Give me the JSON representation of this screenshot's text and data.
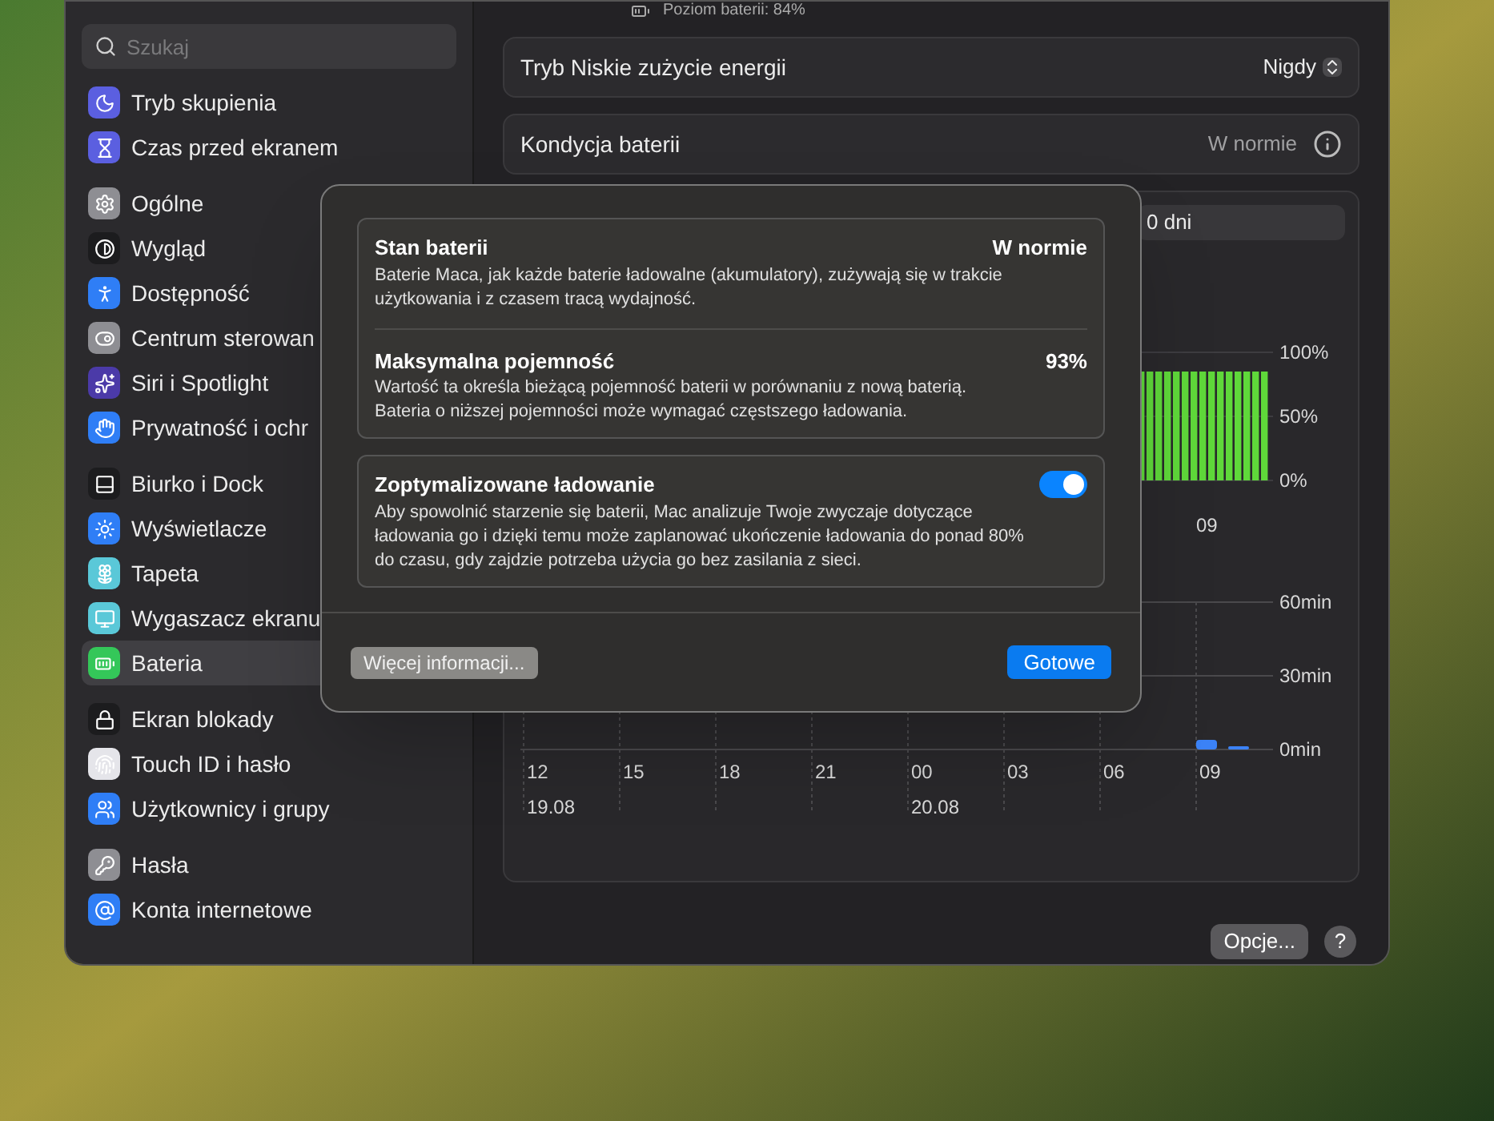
{
  "sidebar": {
    "search": {
      "placeholder": "Szukaj"
    },
    "groups": [
      [
        {
          "label": "Tryb skupienia",
          "selected": false
        },
        {
          "label": "Czas przed ekranem",
          "selected": false
        }
      ],
      [
        {
          "label": "Ogólne",
          "selected": false
        },
        {
          "label": "Wygląd",
          "selected": false
        },
        {
          "label": "Dostępność",
          "selected": false
        },
        {
          "label": "Centrum sterowan",
          "selected": false
        },
        {
          "label": "Siri i Spotlight",
          "selected": false
        },
        {
          "label": "Prywatność i ochr",
          "selected": false
        }
      ],
      [
        {
          "label": "Biurko i Dock",
          "selected": false
        },
        {
          "label": "Wyświetlacze",
          "selected": false
        },
        {
          "label": "Tapeta",
          "selected": false
        },
        {
          "label": "Wygaszacz ekranu",
          "selected": false
        },
        {
          "label": "Bateria",
          "selected": true
        }
      ],
      [
        {
          "label": "Ekran blokady",
          "selected": false
        },
        {
          "label": "Touch ID i hasło",
          "selected": false
        },
        {
          "label": "Użytkownicy i grupy",
          "selected": false
        }
      ],
      [
        {
          "label": "Hasła",
          "selected": false
        },
        {
          "label": "Konta internetowe",
          "selected": false
        }
      ]
    ]
  },
  "main": {
    "battery_level": "Poziom baterii: 84%",
    "rows": [
      {
        "kind": "popup",
        "label": "Tryb Niskie zużycie energii",
        "value": "Nigdy"
      },
      {
        "kind": "info",
        "label": "Kondycja baterii",
        "value": "W normie"
      }
    ],
    "range_segment": "0 dni",
    "battery_chart": {
      "y_labels": [
        "100%",
        "50%",
        "0%"
      ],
      "x_labels": [
        "09"
      ]
    },
    "usage_chart": {
      "y_labels": [
        "60min",
        "30min",
        "0min"
      ],
      "x_labels": [
        "12",
        "15",
        "18",
        "21",
        "00",
        "03",
        "06",
        "09"
      ],
      "dates": [
        "19.08",
        "20.08"
      ]
    },
    "buttons": {
      "options": "Opcje...",
      "help": "?"
    }
  },
  "dialog": {
    "sections": [
      {
        "title": "Stan baterii",
        "value": "W normie",
        "text": "Baterie Maca, jak każde baterie ładowalne (akumulatory), zużywają się w trakcie użytkowania i z czasem tracą wydajność."
      },
      {
        "title": "Maksymalna pojemność",
        "value": "93%",
        "text": "Wartość ta określa bieżącą pojemność baterii w porównaniu z nową baterią. Bateria o niższej pojemności może wymagać częstszego ładowania."
      }
    ],
    "optimized_charging": {
      "title": "Zoptymalizowane ładowanie",
      "on": true,
      "text": "Aby spowolnić starzenie się baterii, Mac analizuje Twoje zwyczaje dotyczące ładowania go i dzięki temu może zaplanować ukończenie ładowania do ponad 80% do czasu, gdy zajdzie potrzeba użycia go bez zasilania z sieci."
    },
    "more_button": "Więcej informacji...",
    "done_button": "Gotowe"
  }
}
